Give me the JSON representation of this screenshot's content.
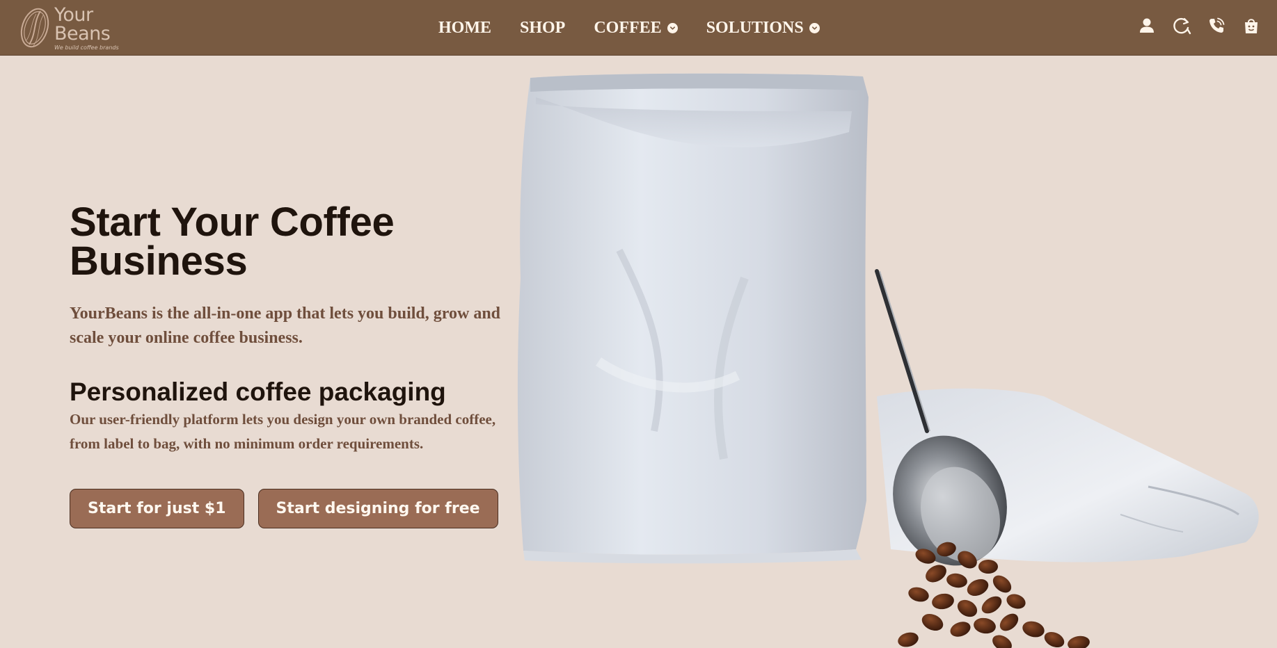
{
  "brand": {
    "logo_line1": "Your",
    "logo_line2": "Beans",
    "tagline": "We build coffee brands"
  },
  "nav": {
    "items": [
      {
        "label": "HOME",
        "dropdown": false
      },
      {
        "label": "SHOP",
        "dropdown": false
      },
      {
        "label": "COFFEE",
        "dropdown": true
      },
      {
        "label": "SOLUTIONS",
        "dropdown": true
      }
    ]
  },
  "header_icons": [
    "user-icon",
    "refresh-icon",
    "phone-icon",
    "cart-bag-icon"
  ],
  "hero": {
    "title": "Start Your Coffee Business",
    "lead": "YourBeans is the all-in-one app that lets you build, grow and scale your online coffee business.",
    "subtitle": "Personalized coffee packaging",
    "body": "Our user-friendly platform lets you design your own branded coffee, from label to bag, with no minimum order requirements.",
    "primary_button": "Start for just $1",
    "secondary_button": "Start designing for free"
  },
  "colors": {
    "header_bg": "#785a41",
    "page_bg": "#e8dbd2",
    "button_bg": "#9a6c55",
    "heading": "#1f140d",
    "body_text": "#6f4e3c"
  }
}
